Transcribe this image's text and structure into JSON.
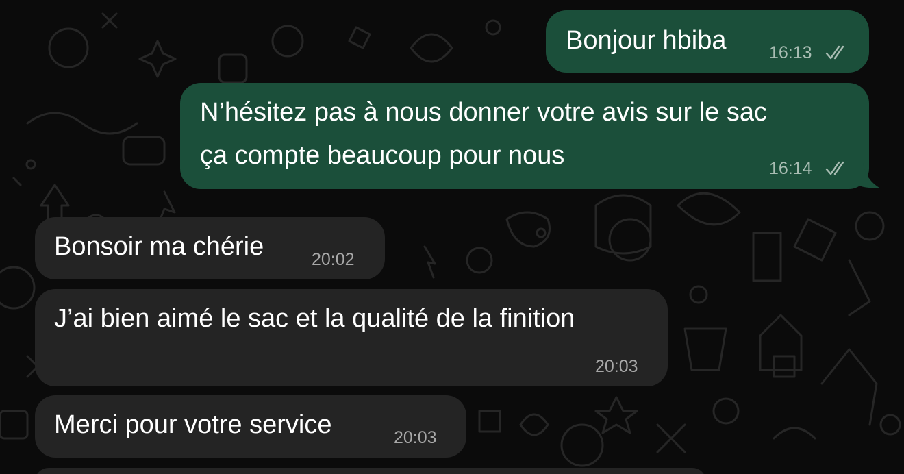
{
  "messages": [
    {
      "direction": "outgoing",
      "text": "Bonjour hbiba",
      "time": "16:13",
      "status_icon": "double-check-icon"
    },
    {
      "direction": "outgoing",
      "lines": [
        "N’hésitez pas à nous donner votre avis sur le sac",
        "ça compte beaucoup pour nous"
      ],
      "time": "16:14",
      "status_icon": "double-check-icon"
    },
    {
      "direction": "incoming",
      "text": "Bonsoir ma chérie",
      "time": "20:02"
    },
    {
      "direction": "incoming",
      "text": "J’ai bien aimé le sac et la qualité de la finition",
      "time": "20:03"
    },
    {
      "direction": "incoming",
      "text": "Merci pour votre service",
      "time": "20:03"
    }
  ],
  "colors": {
    "background": "#0b0b0b",
    "outgoing_bubble": "#1b4f3a",
    "incoming_bubble": "#242424",
    "text": "#ffffff"
  }
}
